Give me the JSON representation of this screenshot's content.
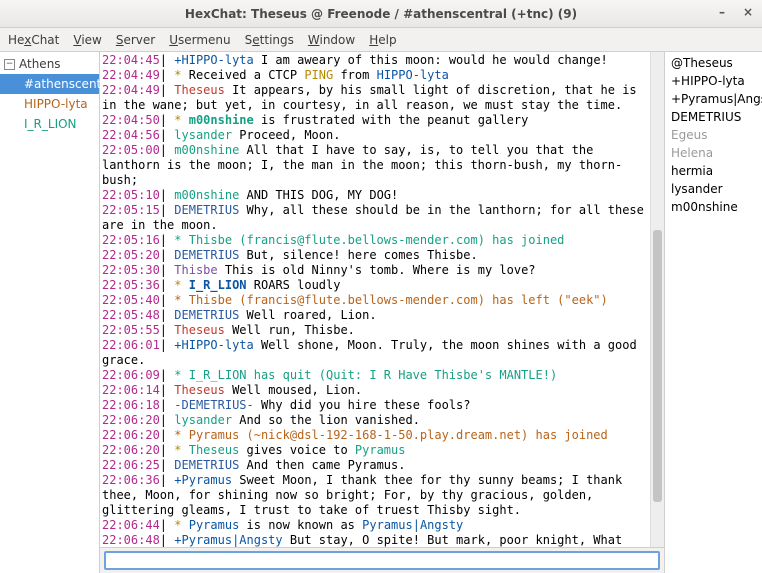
{
  "window": {
    "title": "HexChat: Theseus @ Freenode / #athenscentral (+tnc) (9)"
  },
  "menu": {
    "hexchat": "HexChat",
    "view": "View",
    "server": "Server",
    "usermenu": "Usermenu",
    "settings": "Settings",
    "window": "Window",
    "help": "Help"
  },
  "tree": {
    "network": "Athens",
    "channels": [
      {
        "label": "#athenscentral",
        "sel": true,
        "color": ""
      },
      {
        "label": "HIPPO-lyta",
        "sel": false,
        "color": "#b7641a"
      },
      {
        "label": "I_R_LION",
        "sel": false,
        "color": "#16a085"
      }
    ]
  },
  "users": [
    {
      "label": "@Theseus",
      "cls": "u-op"
    },
    {
      "label": "+HIPPO-lyta",
      "cls": "u-reg"
    },
    {
      "label": "+Pyramus|Angsty",
      "cls": "u-reg"
    },
    {
      "label": "DEMETRIUS",
      "cls": "u-reg"
    },
    {
      "label": "Egeus",
      "cls": "u-dim"
    },
    {
      "label": "Helena",
      "cls": "u-dim"
    },
    {
      "label": "hermia",
      "cls": "u-reg"
    },
    {
      "label": "lysander",
      "cls": "u-reg"
    },
    {
      "label": "m00nshine",
      "cls": "u-reg"
    }
  ],
  "input": {
    "value": ""
  },
  "log": [
    {
      "t": "22:04:45",
      "kind": "msg",
      "nick": "+HIPPO-lyta",
      "ncls": "nk-hippo",
      "text": "I am aweary of this moon: would he would change!"
    },
    {
      "t": "22:04:49",
      "kind": "ctcp",
      "pre": "*",
      "text1": " Received a CTCP ",
      "kw": "PING",
      "text2": " from ",
      "who": "HIPPO-lyta"
    },
    {
      "t": "22:04:49",
      "kind": "msg",
      "nick": "Theseus",
      "ncls": "nk-theseus",
      "text": "It appears, by his small light of discretion, that he is in the wane; but yet, in courtesy, in all reason, we must stay the time."
    },
    {
      "t": "22:04:50",
      "kind": "action",
      "pre": "*",
      "who": "m00nshine",
      "wcls": "nk-m00n",
      "bold": true,
      "text": "is frustrated with the peanut gallery"
    },
    {
      "t": "22:04:56",
      "kind": "msg",
      "nick": "lysander",
      "ncls": "nk-lys",
      "text": "Proceed, Moon."
    },
    {
      "t": "22:05:00",
      "kind": "msg",
      "nick": "m00nshine",
      "ncls": "nk-m00n",
      "text": "All that I have to say, is, to tell you that the lanthorn is the moon; I, the man in the moon; this thorn-bush, my thorn-bush;"
    },
    {
      "t": "22:05:10",
      "kind": "msg",
      "nick": "m00nshine",
      "ncls": "nk-m00n",
      "text": "AND THIS DOG, MY DOG!"
    },
    {
      "t": "22:05:15",
      "kind": "msg",
      "nick": "DEMETRIUS",
      "ncls": "nk-dem",
      "text": "Why, all these should be in the lanthorn; for all these are in the moon."
    },
    {
      "t": "22:05:16",
      "kind": "join",
      "pre": "*",
      "text": " Thisbe (francis@flute.bellows-mender.com) has joined"
    },
    {
      "t": "22:05:20",
      "kind": "msg",
      "nick": "DEMETRIUS",
      "ncls": "nk-dem",
      "text": "But, silence! here comes Thisbe."
    },
    {
      "t": "22:05:30",
      "kind": "msg",
      "nick": "Thisbe",
      "ncls": "nk-thisbe",
      "text": "This is old Ninny's tomb. Where is my love?"
    },
    {
      "t": "22:05:36",
      "kind": "action",
      "pre": "*",
      "who": "I_R_LION",
      "wcls": "nk-irl",
      "bold": true,
      "text": "ROARS loudly"
    },
    {
      "t": "22:05:40",
      "kind": "part",
      "pre": "*",
      "text": " Thisbe (francis@flute.bellows-mender.com) has left (\"eek\")"
    },
    {
      "t": "22:05:48",
      "kind": "msg",
      "nick": "DEMETRIUS",
      "ncls": "nk-dem",
      "text": "Well roared, Lion."
    },
    {
      "t": "22:05:55",
      "kind": "msg",
      "nick": "Theseus",
      "ncls": "nk-theseus",
      "text": "Well run, Thisbe."
    },
    {
      "t": "22:06:01",
      "kind": "msg",
      "nick": "+HIPPO-lyta",
      "ncls": "nk-hippo",
      "text": "Well shone, Moon. Truly, the moon shines with a good grace."
    },
    {
      "t": "22:06:09",
      "kind": "quit",
      "pre": "*",
      "text": " I_R_LION has quit (Quit: I R Have Thisbe's MANTLE!)"
    },
    {
      "t": "22:06:14",
      "kind": "msg",
      "nick": "Theseus",
      "ncls": "nk-theseus",
      "text": "Well moused, Lion."
    },
    {
      "t": "22:06:18",
      "kind": "notice",
      "nick": "-DEMETRIUS-",
      "ncls": "nk-dem",
      "text": "Why did you hire these fools?"
    },
    {
      "t": "22:06:20",
      "kind": "msg",
      "nick": "lysander",
      "ncls": "nk-lys",
      "text": "And so the lion vanished."
    },
    {
      "t": "22:06:20",
      "kind": "join2",
      "pre": "*",
      "text": " Pyramus (~nick@dsl-192-168-1-50.play.dream.net) has joined"
    },
    {
      "t": "22:06:20",
      "kind": "voice",
      "pre": "*",
      "who1": "Theseus",
      "mid": " gives voice to ",
      "who2": "Pyramus"
    },
    {
      "t": "22:06:25",
      "kind": "msg",
      "nick": "DEMETRIUS",
      "ncls": "nk-dem",
      "text": "And then came Pyramus."
    },
    {
      "t": "22:06:36",
      "kind": "msg",
      "nick": "+Pyramus",
      "ncls": "nk-pyr",
      "text": "Sweet Moon, I thank thee for thy sunny beams; I thank thee, Moon, for shining now so bright; For, by thy gracious, golden, glittering gleams, I trust to take of truest Thisby sight."
    },
    {
      "t": "22:06:44",
      "kind": "nickchg",
      "pre": "*",
      "who1": "Pyramus",
      "mid": " is now known as ",
      "who2": "Pyramus|Angsty"
    },
    {
      "t": "22:06:48",
      "kind": "msg",
      "nick": "+Pyramus|Angsty",
      "ncls": "nk-pyra",
      "text": "But stay, O spite! But mark, poor knight, What dreadful dole is here!"
    }
  ]
}
